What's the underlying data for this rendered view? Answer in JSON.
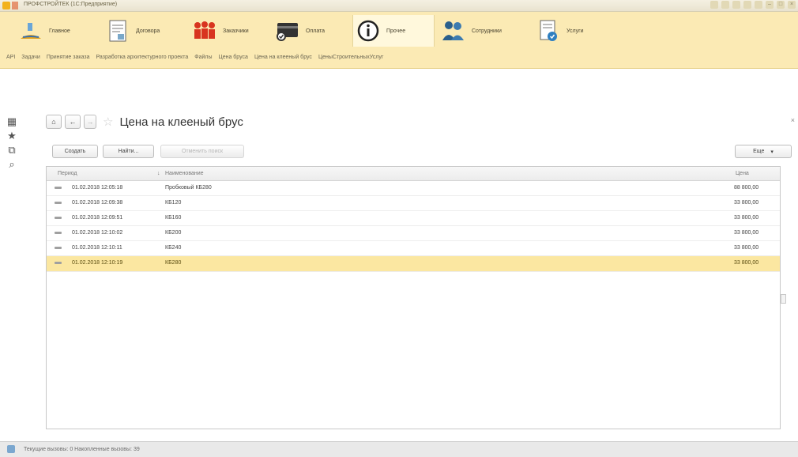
{
  "window": {
    "title": "ПРОФСТРОЙТЕК (1С:Предприятие)"
  },
  "sections": [
    {
      "label": "Главное",
      "icon": "home-section-icon"
    },
    {
      "label": "Договора",
      "icon": "contract-doc-icon"
    },
    {
      "label": "Заказчики",
      "icon": "customers-group-icon"
    },
    {
      "label": "Оплата",
      "icon": "payment-card-icon"
    },
    {
      "label": "Прочее",
      "icon": "info-circle-icon"
    },
    {
      "label": "Сотрудники",
      "icon": "employees-icon"
    },
    {
      "label": "Услуги",
      "icon": "services-icon"
    }
  ],
  "subnav": [
    "API",
    "Задачи",
    "Принятие заказа",
    "Разработка архитектурного проекта",
    "Файлы",
    "Цена бруса",
    "Цена на клееный брус",
    "ЦеныСтроительныхУслуг"
  ],
  "page": {
    "title": "Цена на клееный брус"
  },
  "toolbar": {
    "create": "Создать",
    "find": "Найти...",
    "cancel_search": "Отменить поиск",
    "more": "Еще"
  },
  "table": {
    "columns": [
      "Период",
      "Наименование",
      "Цена"
    ],
    "rows": [
      {
        "period": "01.02.2018 12:05:18",
        "name": "Пробковый КБ280",
        "price": "88 800,00"
      },
      {
        "period": "01.02.2018 12:09:38",
        "name": "КБ120",
        "price": "33 800,00"
      },
      {
        "period": "01.02.2018 12:09:51",
        "name": "КБ160",
        "price": "33 800,00"
      },
      {
        "period": "01.02.2018 12:10:02",
        "name": "КБ200",
        "price": "33 800,00"
      },
      {
        "period": "01.02.2018 12:10:11",
        "name": "КБ240",
        "price": "33 800,00"
      },
      {
        "period": "01.02.2018 12:10:19",
        "name": "КБ280",
        "price": "33 800,00"
      }
    ],
    "selected_index": 5
  },
  "status": {
    "text": "Текущие вызовы: 0   Накопленные вызовы: 39"
  }
}
